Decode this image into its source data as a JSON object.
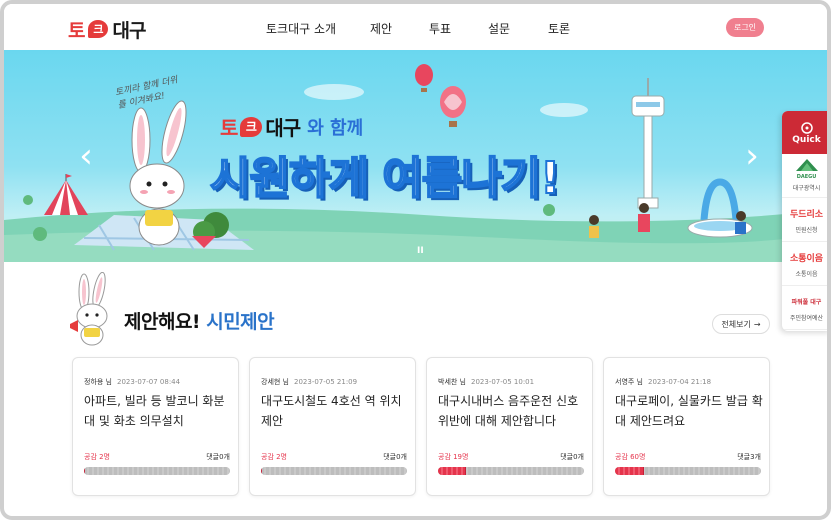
{
  "header": {
    "logo": {
      "part1": "토",
      "bubble": "크",
      "part2": "대구"
    },
    "nav": [
      "토크대구 소개",
      "제안",
      "투표",
      "설문",
      "토론"
    ],
    "login_label": "로그인"
  },
  "banner": {
    "handwriting": "토끼라 함께 더위를 이겨봐요!",
    "sub_logo": {
      "part1": "토",
      "bubble": "크",
      "part2": "대구"
    },
    "sub_text": "와 함께",
    "headline": "시원하게 여름나기!",
    "pager": "II",
    "prev_icon": "chevron-left-icon",
    "next_icon": "chevron-right-icon",
    "rabbit_tag": "토끼"
  },
  "quick": {
    "title": "Quick",
    "items": [
      {
        "logo": "DAEGU",
        "label": "대구광역시"
      },
      {
        "logo": "두드리소",
        "label": "민원신청"
      },
      {
        "logo": "소통이음",
        "label": "소통이음"
      },
      {
        "logo": "파워풀 대구",
        "label": "주민참여예산"
      }
    ]
  },
  "section": {
    "title_main": "제안해요!",
    "title_accent": "시민제안",
    "more_label": "전체보기",
    "more_icon": "arrow-right-icon"
  },
  "cards": [
    {
      "author": "정하용 님",
      "date": "2023-07-07 08:44",
      "title": "아파트, 빌라 등 발코니 화분대 및 화초 의무설치",
      "likes": "공감 2명",
      "comments": "댓글0개",
      "progress": 0.01
    },
    {
      "author": "강세현 님",
      "date": "2023-07-05 21:09",
      "title": "대구도시철도 4호선 역 위치 제안",
      "likes": "공감 2명",
      "comments": "댓글0개",
      "progress": 0.01
    },
    {
      "author": "박세찬 님",
      "date": "2023-07-05 10:01",
      "title": "대구시내버스 음주운전 신호위반에 대해 제안합니다",
      "likes": "공감 19명",
      "comments": "댓글0개",
      "progress": 0.19
    },
    {
      "author": "서영주 님",
      "date": "2023-07-04 21:18",
      "title": "대구로페이, 실물카드 발급 확대 제안드려요",
      "likes": "공감 60명",
      "comments": "댓글3개",
      "progress": 0.2
    }
  ],
  "colors": {
    "brand_red": "#e53b3b",
    "quick_red": "#cc2a36",
    "accent_blue": "#2a73c9",
    "like_red": "#e5344c"
  }
}
